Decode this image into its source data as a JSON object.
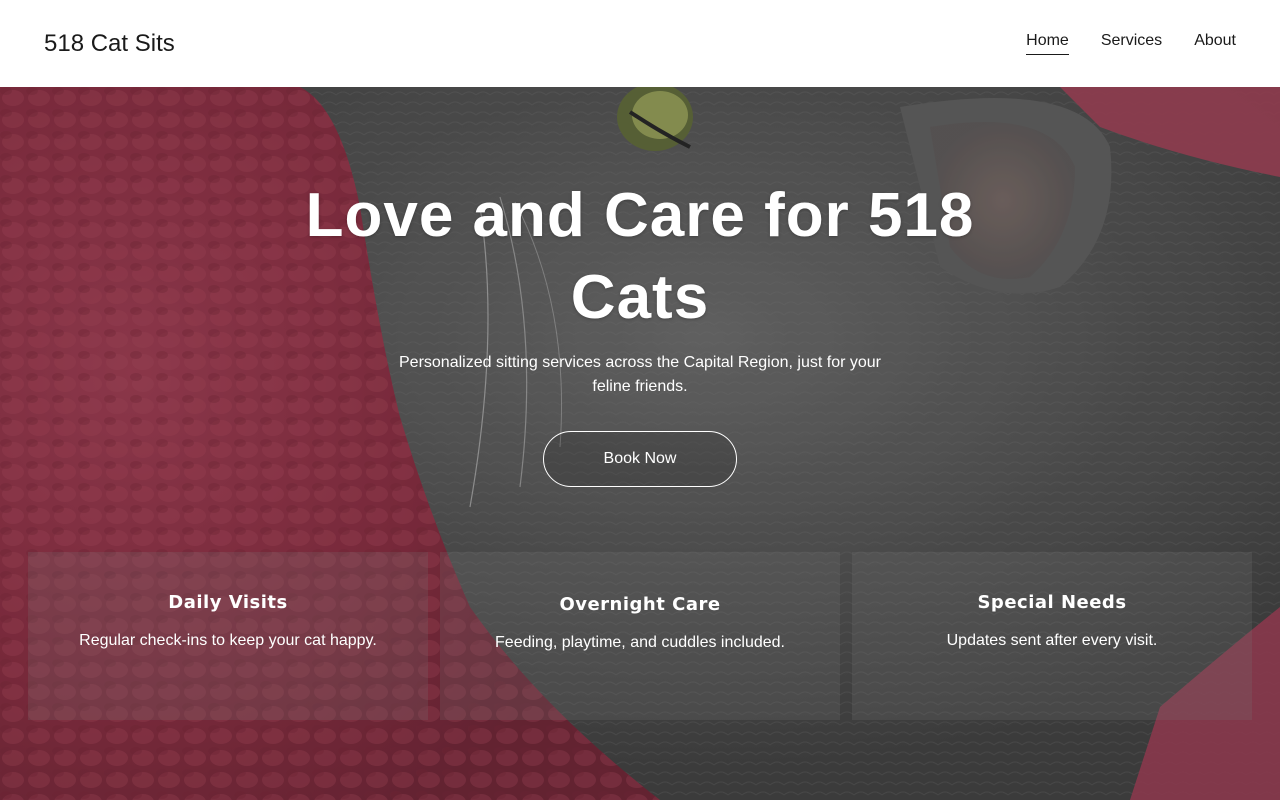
{
  "header": {
    "logo": "518 Cat Sits",
    "nav": [
      {
        "label": "Home",
        "active": true
      },
      {
        "label": "Services",
        "active": false
      },
      {
        "label": "About",
        "active": false
      }
    ]
  },
  "hero": {
    "title": "Love and Care for 518 Cats",
    "subtitle": "Personalized sitting services across the Capital Region, just for your feline friends.",
    "cta_label": "Book Now",
    "background": "photo of a grey cat lying on a pink knitted blanket"
  },
  "cards": [
    {
      "title": "Daily Visits",
      "text": "Regular check-ins to keep your cat happy."
    },
    {
      "title": "Overnight Care",
      "text": "Feeding, playtime, and cuddles included."
    },
    {
      "title": "Special Needs",
      "text": "Updates sent after every visit."
    }
  ],
  "colors": {
    "header_bg": "#ffffff",
    "text_dark": "#1a1a1a",
    "hero_text": "#ffffff",
    "blanket": "#a83a52",
    "cat_fur": "#6a6a6a"
  }
}
